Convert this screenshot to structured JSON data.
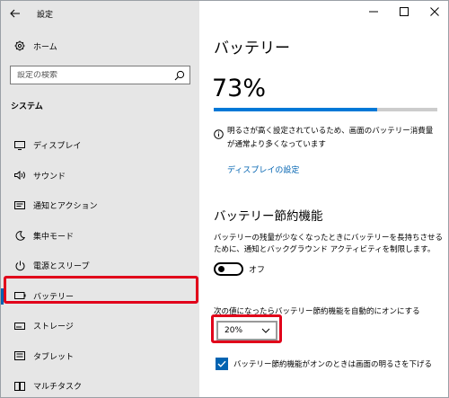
{
  "window": {
    "app_title": "設定",
    "controls": {
      "minimize_icon": "minimize-icon",
      "maximize_icon": "maximize-icon",
      "close_icon": "close-icon"
    }
  },
  "sidebar": {
    "home": {
      "label": "ホーム",
      "icon": "gear-icon"
    },
    "search": {
      "placeholder": "設定の検索",
      "icon": "search-icon"
    },
    "section_label": "システム",
    "items": [
      {
        "label": "ディスプレイ",
        "icon": "display-icon",
        "active": false
      },
      {
        "label": "サウンド",
        "icon": "speaker-icon",
        "active": false
      },
      {
        "label": "通知とアクション",
        "icon": "notification-icon",
        "active": false
      },
      {
        "label": "集中モード",
        "icon": "moon-icon",
        "active": false
      },
      {
        "label": "電源とスリープ",
        "icon": "power-icon",
        "active": false
      },
      {
        "label": "バッテリー",
        "icon": "battery-icon",
        "active": true
      },
      {
        "label": "ストレージ",
        "icon": "storage-icon",
        "active": false
      },
      {
        "label": "タブレット",
        "icon": "tablet-icon",
        "active": false
      },
      {
        "label": "マルチタスク",
        "icon": "multitask-icon",
        "active": false
      }
    ]
  },
  "main": {
    "title": "バッテリー",
    "battery_percent_text": "73%",
    "battery_level": 0.73,
    "notice": "明るさが高く設定されているため、画面のバッテリー消費量が通常より多くなっています",
    "display_settings_link": "ディスプレイの設定",
    "saver_section_title": "バッテリー節約機能",
    "saver_description": "バッテリーの残量が少なくなったときにバッテリーを長持ちさせるために、通知とバックグラウンド アクティビティを制限します。",
    "toggle_state": "オフ",
    "threshold_label": "次の値になったらバッテリー節約機能を自動的にオンにする",
    "threshold_value": "20%",
    "brightness_checkbox_label": "バッテリー節約機能がオンのときは画面の明るさを下げる",
    "colors": {
      "accent": "#0063b1",
      "progress": "#0078d7",
      "highlight": "#e1001a"
    }
  }
}
